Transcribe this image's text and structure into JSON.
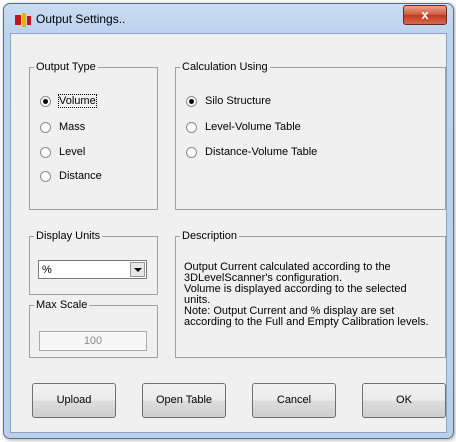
{
  "window": {
    "title": "Output Settings..",
    "close_label": "x"
  },
  "output_type": {
    "legend": "Output Type",
    "options": [
      {
        "label": "Volume",
        "selected": true
      },
      {
        "label": "Mass",
        "selected": false
      },
      {
        "label": "Level",
        "selected": false
      },
      {
        "label": "Distance",
        "selected": false
      }
    ]
  },
  "calculation": {
    "legend": "Calculation Using",
    "options": [
      {
        "label": "Silo Structure",
        "selected": true
      },
      {
        "label": "Level-Volume Table",
        "selected": false
      },
      {
        "label": "Distance-Volume Table",
        "selected": false
      }
    ]
  },
  "display_units": {
    "legend": "Display Units",
    "value": "%"
  },
  "max_scale": {
    "legend": "Max Scale",
    "value": "100"
  },
  "description": {
    "legend": "Description",
    "lines": [
      "Output Current calculated according to the",
      "3DLevelScanner's configuration.",
      "Volume is displayed according to the selected",
      "units.",
      "Note: Output Current and % display are set",
      "according to the Full and Empty Calibration levels."
    ]
  },
  "buttons": {
    "upload": "Upload",
    "open_table": "Open Table",
    "cancel": "Cancel",
    "ok": "OK"
  },
  "colors": {
    "title_bar": "#bcd2ee",
    "close_button": "#c9442a",
    "dialog_body": "#f0f0f0"
  }
}
